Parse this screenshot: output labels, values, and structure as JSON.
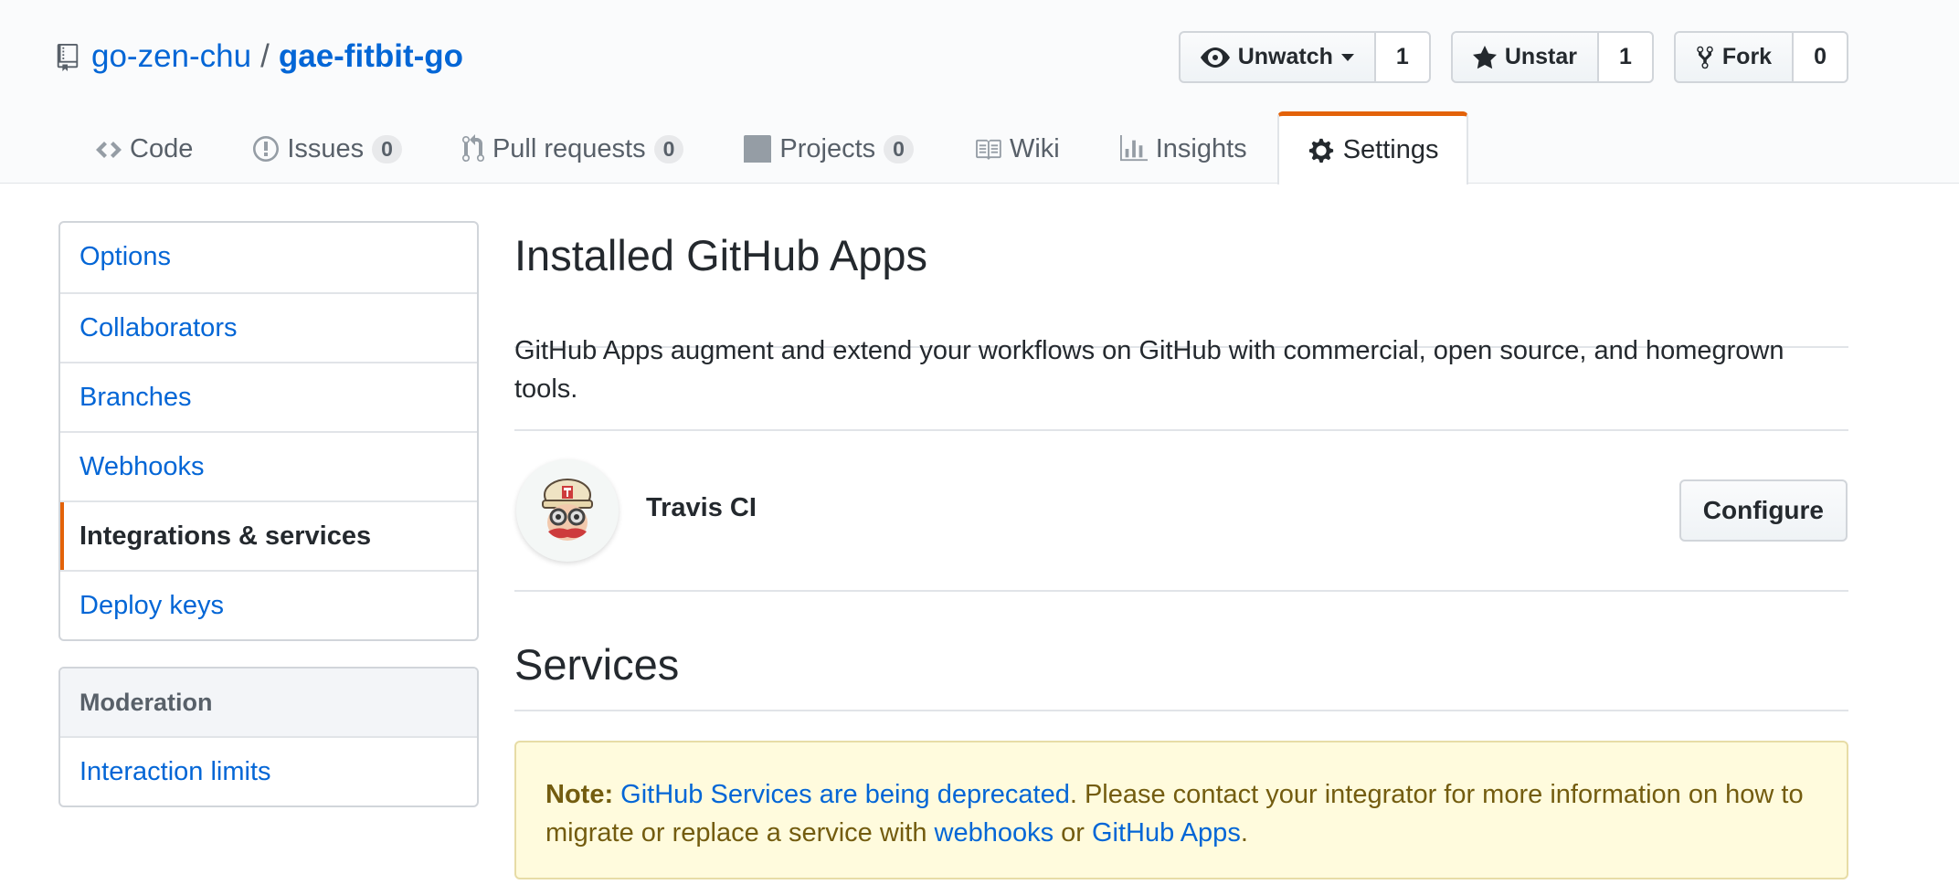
{
  "repo": {
    "owner": "go-zen-chu",
    "separator": "/",
    "name": "gae-fitbit-go"
  },
  "actions": {
    "watch": {
      "label": "Unwatch",
      "count": "1",
      "icon": "eye-icon"
    },
    "star": {
      "label": "Unstar",
      "count": "1",
      "icon": "star-icon"
    },
    "fork": {
      "label": "Fork",
      "count": "0",
      "icon": "repo-forked-icon"
    }
  },
  "tabs": [
    {
      "label": "Code",
      "icon": "code-icon"
    },
    {
      "label": "Issues",
      "count": "0",
      "icon": "issue-opened-icon"
    },
    {
      "label": "Pull requests",
      "count": "0",
      "icon": "git-pull-request-icon"
    },
    {
      "label": "Projects",
      "count": "0",
      "icon": "project-icon"
    },
    {
      "label": "Wiki",
      "icon": "book-icon"
    },
    {
      "label": "Insights",
      "icon": "graph-icon"
    },
    {
      "label": "Settings",
      "icon": "gear-icon",
      "selected": true
    }
  ],
  "sidebar": {
    "items": [
      {
        "label": "Options"
      },
      {
        "label": "Collaborators"
      },
      {
        "label": "Branches"
      },
      {
        "label": "Webhooks"
      },
      {
        "label": "Integrations & services",
        "selected": true
      },
      {
        "label": "Deploy keys"
      }
    ],
    "moderation": {
      "heading": "Moderation",
      "items": [
        {
          "label": "Interaction limits"
        }
      ]
    }
  },
  "main": {
    "apps_title": "Installed GitHub Apps",
    "apps_description": "GitHub Apps augment and extend your workflows on GitHub with commercial, open source, and homegrown tools.",
    "app": {
      "name": "Travis CI",
      "configure_label": "Configure"
    },
    "services_title": "Services",
    "note": {
      "label": "Note:",
      "link1": "GitHub Services are being deprecated",
      "text1": ". Please contact your integrator for more information on how to migrate or replace a service with ",
      "link2": "webhooks",
      "text2": " or ",
      "link3": "GitHub Apps",
      "text3": "."
    }
  },
  "colors": {
    "link": "#0366d6",
    "accent": "#e36209",
    "text": "#24292e",
    "muted": "#586069",
    "warn_bg": "#fffbdd"
  }
}
